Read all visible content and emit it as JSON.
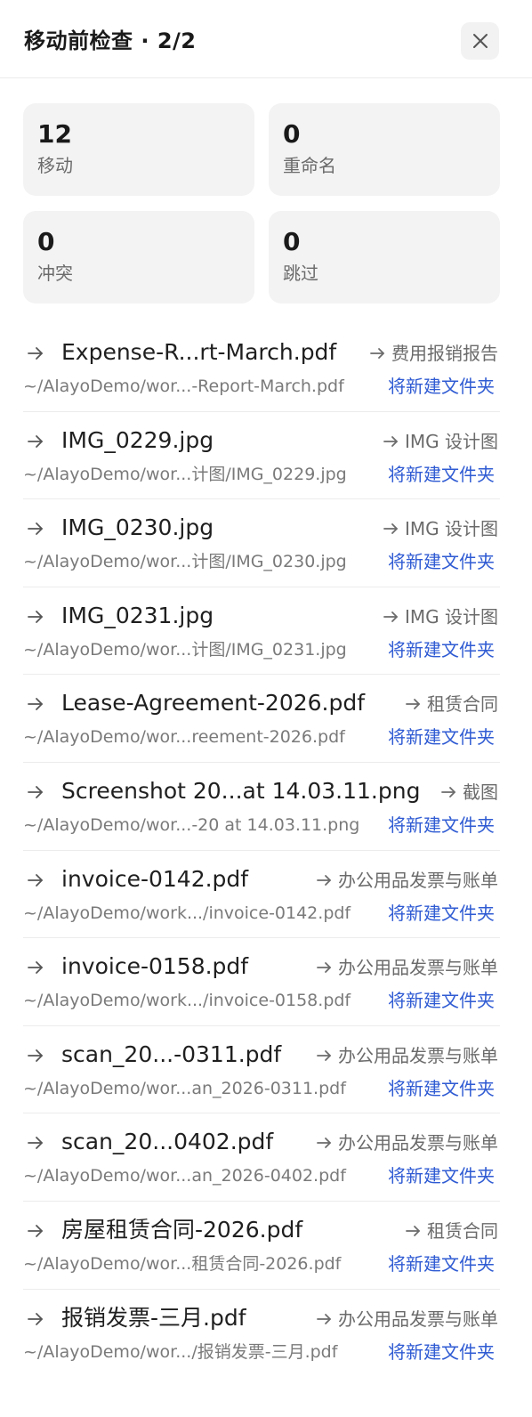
{
  "header": {
    "title": "移动前检查 · 2/2"
  },
  "stats": [
    {
      "value": "12",
      "label": "移动"
    },
    {
      "value": "0",
      "label": "重命名"
    },
    {
      "value": "0",
      "label": "冲突"
    },
    {
      "value": "0",
      "label": "跳过"
    }
  ],
  "items": [
    {
      "name": "Expense-R...rt-March.pdf",
      "target": "费用报销报告",
      "path": "~/AlayoDemo/wor...-Report-March.pdf",
      "badge": "将新建文件夹"
    },
    {
      "name": "IMG_0229.jpg",
      "target": "IMG 设计图",
      "path": "~/AlayoDemo/wor...计图/IMG_0229.jpg",
      "badge": "将新建文件夹"
    },
    {
      "name": "IMG_0230.jpg",
      "target": "IMG 设计图",
      "path": "~/AlayoDemo/wor...计图/IMG_0230.jpg",
      "badge": "将新建文件夹"
    },
    {
      "name": "IMG_0231.jpg",
      "target": "IMG 设计图",
      "path": "~/AlayoDemo/wor...计图/IMG_0231.jpg",
      "badge": "将新建文件夹"
    },
    {
      "name": "Lease-Agreement-2026.pdf",
      "target": "租赁合同",
      "path": "~/AlayoDemo/wor...reement-2026.pdf",
      "badge": "将新建文件夹"
    },
    {
      "name": "Screenshot 20...at 14.03.11.png",
      "target": "截图",
      "path": "~/AlayoDemo/wor...-20 at 14.03.11.png",
      "badge": "将新建文件夹"
    },
    {
      "name": "invoice-0142.pdf",
      "target": "办公用品发票与账单",
      "path": "~/AlayoDemo/work.../invoice-0142.pdf",
      "badge": "将新建文件夹"
    },
    {
      "name": "invoice-0158.pdf",
      "target": "办公用品发票与账单",
      "path": "~/AlayoDemo/work.../invoice-0158.pdf",
      "badge": "将新建文件夹"
    },
    {
      "name": "scan_20...-0311.pdf",
      "target": "办公用品发票与账单",
      "path": "~/AlayoDemo/wor...an_2026-0311.pdf",
      "badge": "将新建文件夹"
    },
    {
      "name": "scan_20...0402.pdf",
      "target": "办公用品发票与账单",
      "path": "~/AlayoDemo/wor...an_2026-0402.pdf",
      "badge": "将新建文件夹"
    },
    {
      "name": "房屋租赁合同-2026.pdf",
      "target": "租赁合同",
      "path": "~/AlayoDemo/wor...租赁合同-2026.pdf",
      "badge": "将新建文件夹"
    },
    {
      "name": "报销发票-三月.pdf",
      "target": "办公用品发票与账单",
      "path": "~/AlayoDemo/wor.../报销发票-三月.pdf",
      "badge": "将新建文件夹"
    }
  ],
  "icons": {
    "close": "close-icon",
    "row_arrow": "arrow-right-icon",
    "target_arrow": "arrow-right-icon"
  },
  "colors": {
    "badge": "#2f5bd3",
    "card_bg": "#f3f3f3",
    "muted_text": "#6b6b6b"
  }
}
